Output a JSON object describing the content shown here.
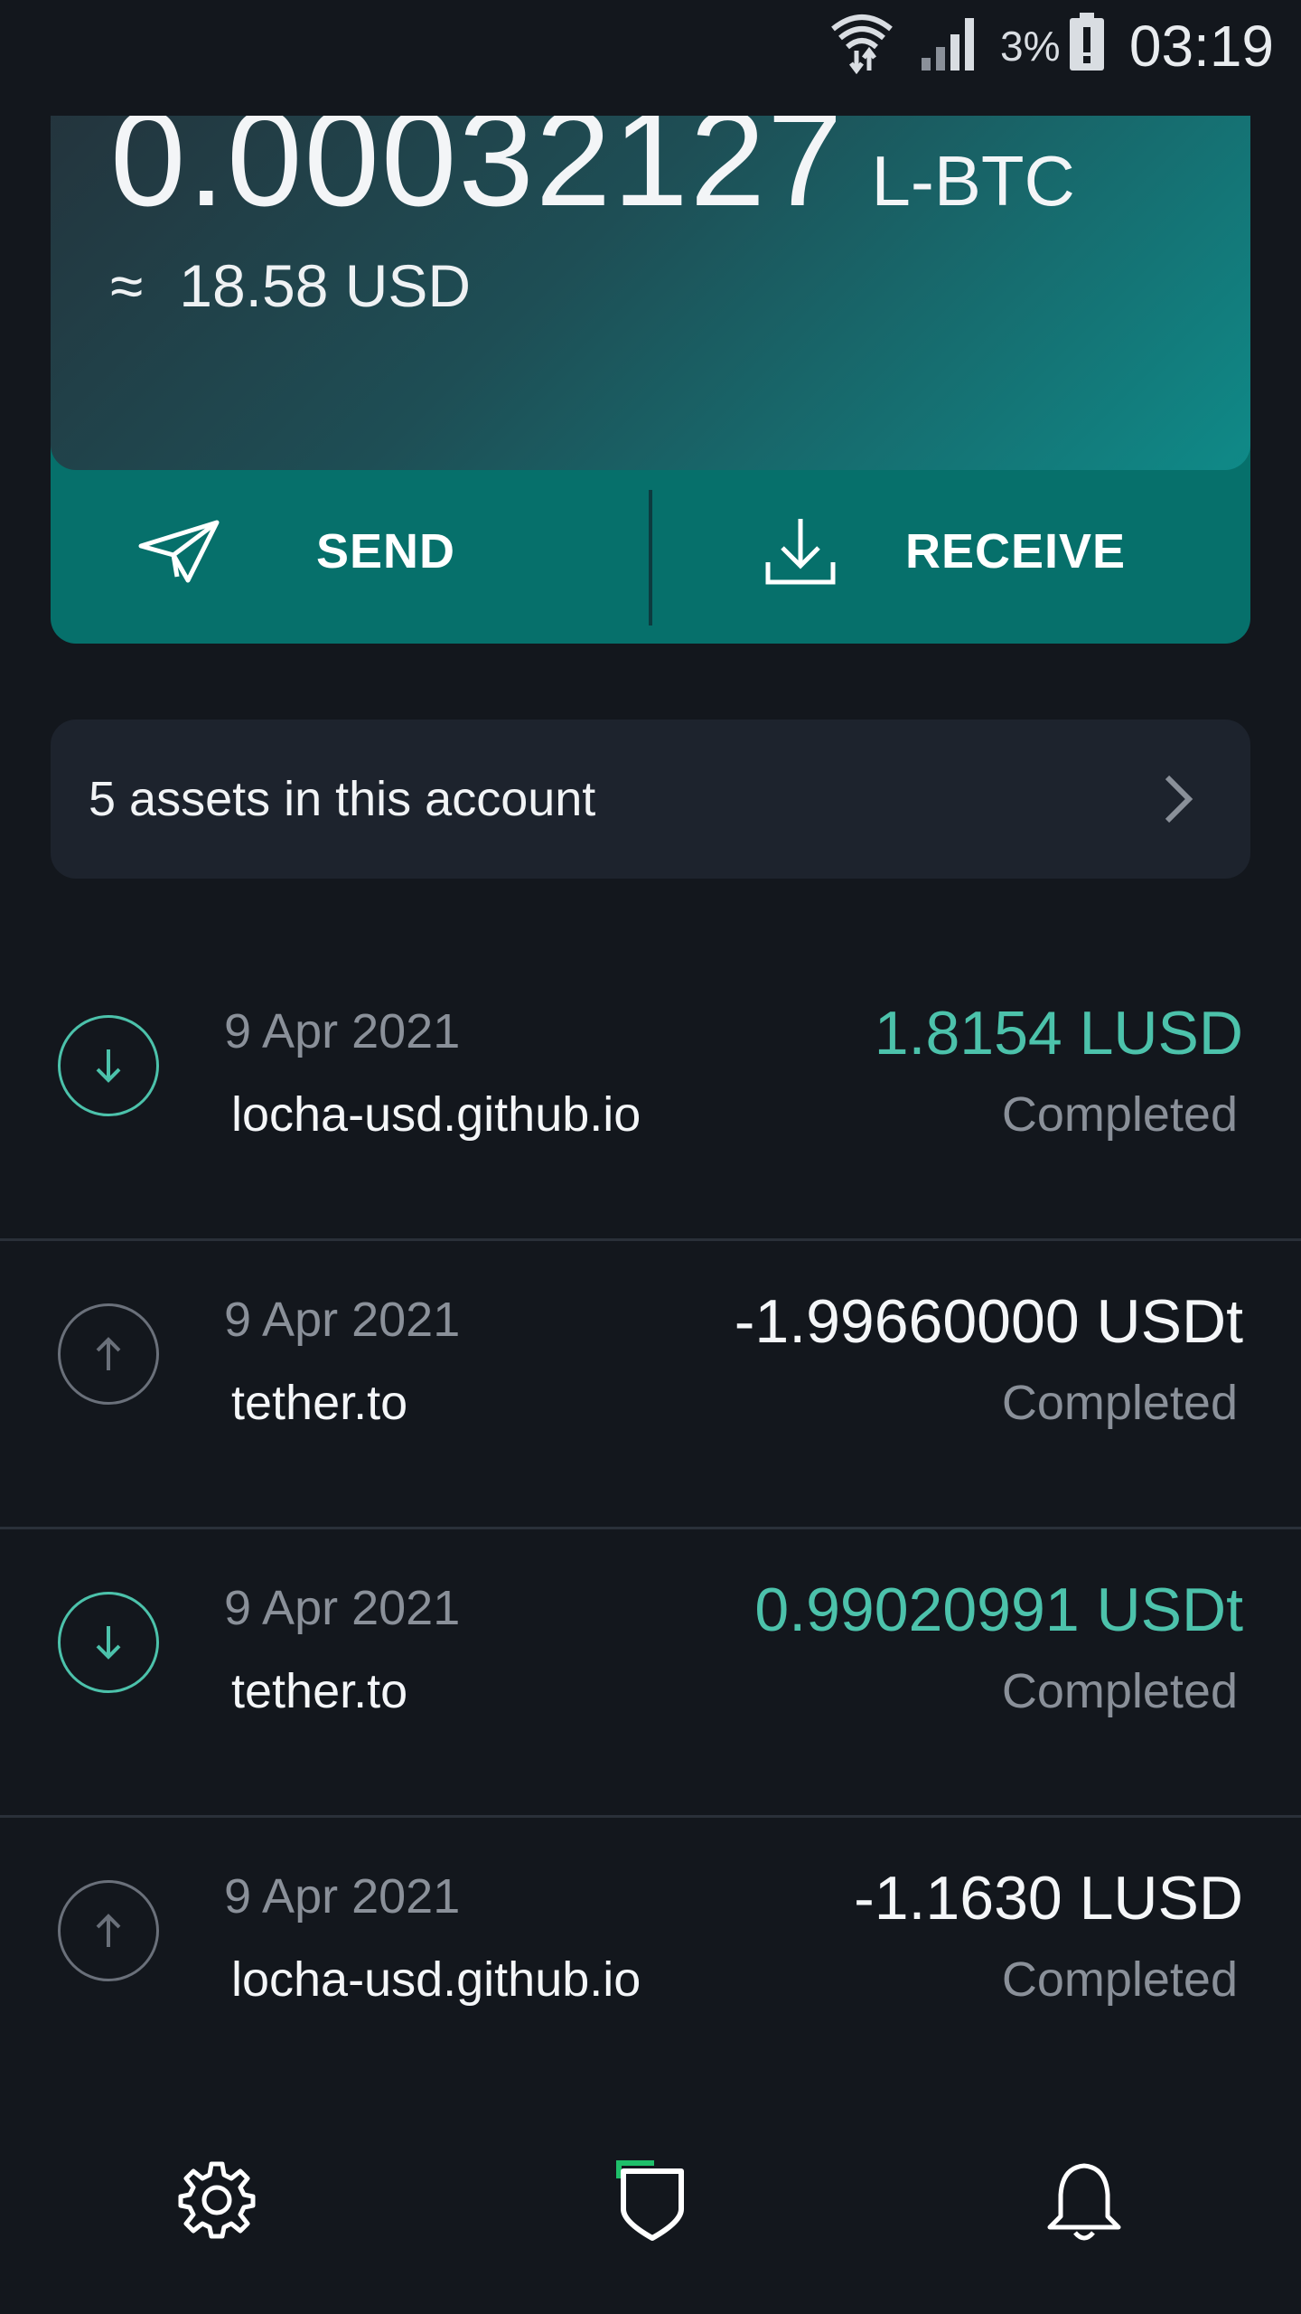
{
  "status_bar": {
    "battery_percent": "3%",
    "time": "03:19"
  },
  "balance": {
    "amount": "0.00032127",
    "unit": "L-BTC",
    "approx_symbol": "≈",
    "fiat": "18.58 USD"
  },
  "actions": {
    "send_label": "SEND",
    "receive_label": "RECEIVE"
  },
  "assets": {
    "label": "5 assets in this account"
  },
  "transactions": [
    {
      "date": "9 Apr 2021",
      "party": "locha-usd.github.io",
      "amount": "1.8154 LUSD",
      "status": "Completed",
      "direction": "in"
    },
    {
      "date": "9 Apr 2021",
      "party": "tether.to",
      "amount": "-1.99660000 USDt",
      "status": "Completed",
      "direction": "out"
    },
    {
      "date": "9 Apr 2021",
      "party": "tether.to",
      "amount": "0.99020991 USDt",
      "status": "Completed",
      "direction": "in"
    },
    {
      "date": "9 Apr 2021",
      "party": "locha-usd.github.io",
      "amount": "-1.1630 LUSD",
      "status": "Completed",
      "direction": "out"
    }
  ],
  "colors": {
    "background": "#13171d",
    "accent": "#06706b",
    "incoming": "#4cc2ab",
    "muted": "#8a9099",
    "brand_green": "#1fbf6a"
  },
  "icons": {
    "status": [
      "wifi-icon",
      "signal-icon",
      "battery-alert-icon"
    ],
    "nav": [
      "settings-gear-icon",
      "wallet-shield-icon",
      "notifications-bell-icon"
    ]
  }
}
